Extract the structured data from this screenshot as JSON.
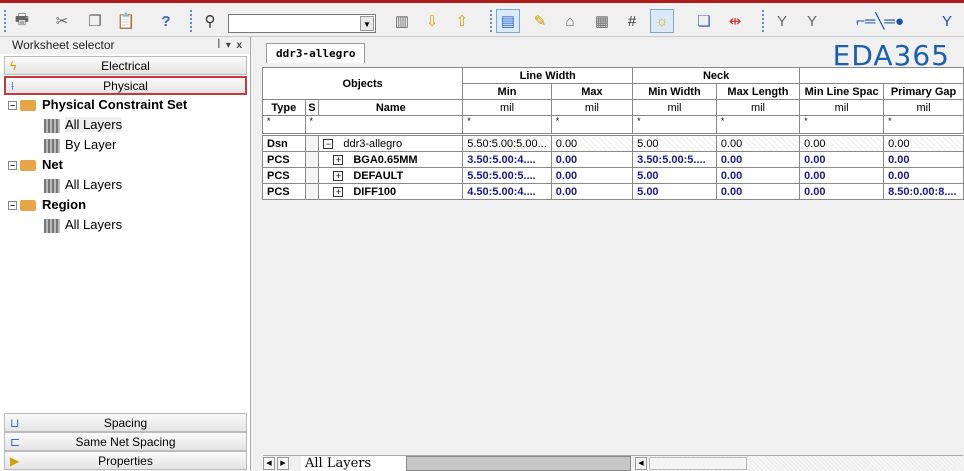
{
  "toolbar": {
    "icons": [
      "print-icon",
      "cut-icon",
      "copy-icon",
      "paste-icon",
      "help-icon",
      "binoculars-icon",
      "bookmark-down-icon",
      "bookmark-up-icon",
      "worksheet-icon",
      "tag-icon",
      "house-icon",
      "grid-icon",
      "hash-icon",
      "sun-icon",
      "window-icon",
      "connector-icon",
      "filter-icon",
      "filter-off-icon",
      "net-topology-icon",
      "filter2-icon",
      "filter3-icon"
    ],
    "search_value": ""
  },
  "sidebar": {
    "title": "Worksheet selector",
    "categories": [
      {
        "label": "Electrical",
        "icon": "lightning-icon"
      },
      {
        "label": "Physical",
        "icon": "physical-icon"
      }
    ],
    "tree": [
      {
        "label": "Physical Constraint Set",
        "level": 0
      },
      {
        "label": "All Layers",
        "level": 1
      },
      {
        "label": "By Layer",
        "level": 1
      },
      {
        "label": "Net",
        "level": 0
      },
      {
        "label": "All Layers",
        "level": 1
      },
      {
        "label": "Region",
        "level": 0
      },
      {
        "label": "All Layers",
        "level": 1
      }
    ],
    "bottom": [
      {
        "label": "Spacing"
      },
      {
        "label": "Same Net Spacing"
      },
      {
        "label": "Properties"
      }
    ]
  },
  "main": {
    "tab": "ddr3-allegro",
    "logo": "EDA365",
    "sheet_tab": "All Layers",
    "headers": {
      "objects": "Objects",
      "line_width": "Line Width",
      "neck": "Neck",
      "type": "Type",
      "s": "S",
      "name": "Name",
      "min": "Min",
      "max": "Max",
      "min_width": "Min Width",
      "max_length": "Max Length",
      "min_line_spac": "Min Line Spac",
      "primary_gap": "Primary Gap",
      "unit": "mil",
      "filter": "*"
    },
    "rows": [
      {
        "type": "Dsn",
        "name": "ddr3-allegro",
        "expander": "−",
        "min": "5.50:5.00:5.00...",
        "max": "0.00",
        "min_width": "5.00",
        "max_length": "0.00",
        "min_line_spac": "0.00",
        "primary_gap": "0.00"
      },
      {
        "type": "PCS",
        "name": "BGA0.65MM",
        "expander": "+",
        "min": "3.50:5.00:4....",
        "max": "0.00",
        "min_width": "3.50:5.00:5....",
        "max_length": "0.00",
        "min_line_spac": "0.00",
        "primary_gap": "0.00"
      },
      {
        "type": "PCS",
        "name": "DEFAULT",
        "expander": "+",
        "min": "5.50:5.00:5....",
        "max": "0.00",
        "min_width": "5.00",
        "max_length": "0.00",
        "min_line_spac": "0.00",
        "primary_gap": "0.00"
      },
      {
        "type": "PCS",
        "name": "DIFF100",
        "expander": "+",
        "min": "4.50:5.00:4....",
        "max": "0.00",
        "min_width": "5.00",
        "max_length": "0.00",
        "min_line_spac": "0.00",
        "primary_gap": "8.50:0.00:8...."
      }
    ]
  },
  "colors": {
    "accent_red": "#b01c1c",
    "value_blue": "#1a1a8a",
    "logo_blue": "#1c5fae"
  }
}
